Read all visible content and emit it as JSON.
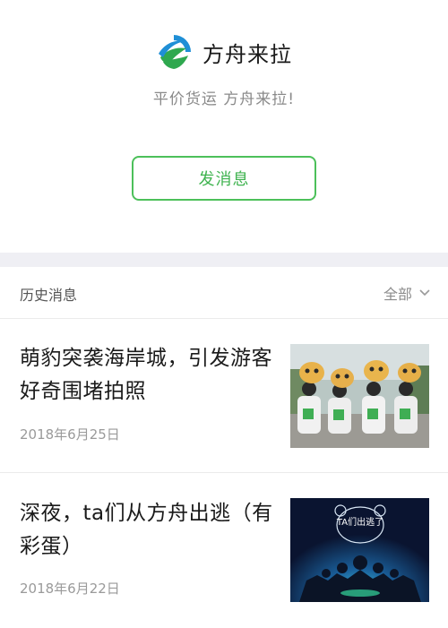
{
  "profile": {
    "brand_name": "方舟来拉",
    "logo_icon": "ark-sail-logo",
    "tagline": "平价货运 方舟来拉!",
    "message_button_label": "发消息"
  },
  "history": {
    "title": "历史消息",
    "filter_label": "全部",
    "articles": [
      {
        "title": "萌豹突袭海岸城，引发游客好奇围堵拍照",
        "date": "2018年6月25日",
        "thumbnail": "group-photo-with-leopard-mascots"
      },
      {
        "title": "深夜，ta们从方舟出逃（有彩蛋）",
        "date": "2018年6月22日",
        "thumbnail": "night-ark-poster",
        "thumbnail_text": "TA们出逃了"
      }
    ]
  },
  "colors": {
    "accent_green": "#4cc05a",
    "logo_blue": "#1f8fd6",
    "logo_green": "#2fa84f",
    "divider_gray": "#efeff4"
  }
}
